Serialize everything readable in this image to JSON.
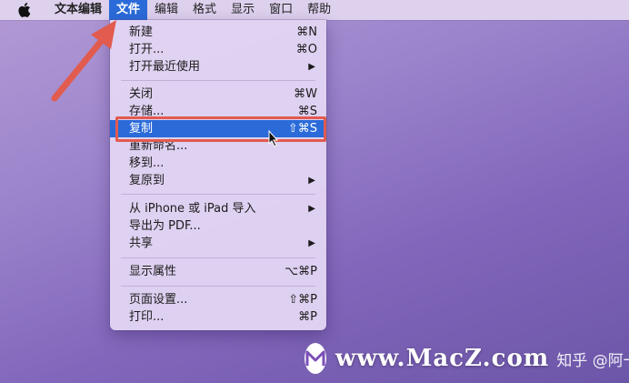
{
  "menubar": {
    "apple_icon": "apple-icon",
    "items": [
      {
        "label": "文本编辑"
      },
      {
        "label": "文件"
      },
      {
        "label": "编辑"
      },
      {
        "label": "格式"
      },
      {
        "label": "显示"
      },
      {
        "label": "窗口"
      },
      {
        "label": "帮助"
      }
    ]
  },
  "file_menu": {
    "items": [
      {
        "label": "新建",
        "shortcut": "⌘N"
      },
      {
        "label": "打开...",
        "shortcut": "⌘O"
      },
      {
        "label": "打开最近使用",
        "submenu": true
      },
      {
        "label": "关闭",
        "shortcut": "⌘W"
      },
      {
        "label": "存储...",
        "shortcut": "⌘S"
      },
      {
        "label": "复制",
        "shortcut": "⇧⌘S",
        "highlighted": true
      },
      {
        "label": "重新命名..."
      },
      {
        "label": "移到..."
      },
      {
        "label": "复原到",
        "submenu": true
      },
      {
        "label": "从 iPhone 或 iPad 导入",
        "submenu": true
      },
      {
        "label": "导出为 PDF..."
      },
      {
        "label": "共享",
        "submenu": true
      },
      {
        "label": "显示属性",
        "shortcut": "⌥⌘P"
      },
      {
        "label": "页面设置...",
        "shortcut": "⇧⌘P"
      },
      {
        "label": "打印...",
        "shortcut": "⌘P"
      }
    ]
  },
  "watermark": {
    "site": "www.MacZ.com",
    "author": "知乎 @阿一阿"
  },
  "colors": {
    "highlight": "#2a6bd9",
    "annotation": "#e15b4f"
  }
}
